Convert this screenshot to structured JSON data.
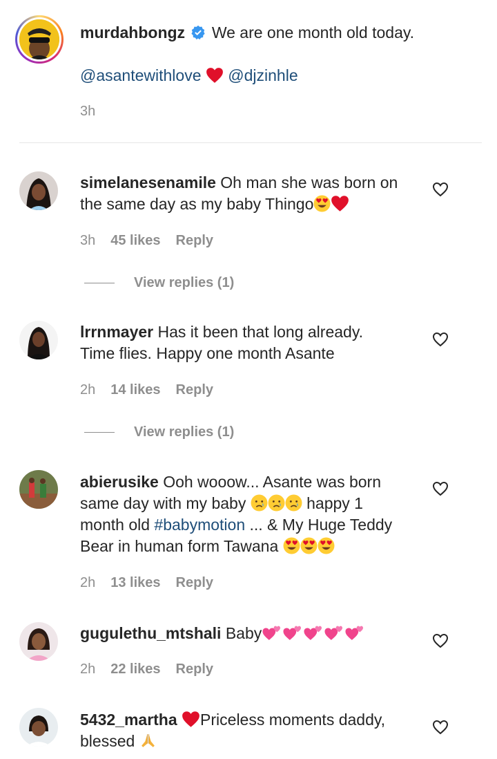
{
  "post": {
    "username": "murdahbongz",
    "caption": "We are one month old today.",
    "mention1": "@asantewithlove",
    "mention2": "@djzinhle",
    "time": "3h"
  },
  "comments": [
    {
      "username": "simelanesenamile",
      "line1": "Oh man she was born on",
      "line2": "the same day as my baby Thingo",
      "time": "3h",
      "likes": "45 likes",
      "reply": "Reply",
      "view_replies": "View replies (1)"
    },
    {
      "username": "lrrnmayer",
      "line1": "Has it been that long already.",
      "line2": "Time flies. Happy one month Asante",
      "time": "2h",
      "likes": "14 likes",
      "reply": "Reply",
      "view_replies": "View replies (1)"
    },
    {
      "username": "abierusike",
      "line1": "Ooh wooow... Asante was born",
      "line2a": "same day with my baby",
      "line2b": "happy 1",
      "line3a": "month old",
      "hashtag": "#babymotion",
      "line3b": "... & My Huge Teddy",
      "line4": "Bear in human form Tawana",
      "time": "2h",
      "likes": "13 likes",
      "reply": "Reply"
    },
    {
      "username": "gugulethu_mtshali",
      "line1": "Baby",
      "time": "2h",
      "likes": "22 likes",
      "reply": "Reply"
    },
    {
      "username": "5432_martha",
      "line1": "Priceless moments daddy,",
      "line2": "blessed"
    }
  ],
  "icons": {
    "verified": "verified-badge-icon",
    "heart": "heart-outline-icon",
    "red_heart": "red-heart-emoji",
    "heart_eyes": "heart-eyes-emoji",
    "crying": "crying-face-emoji",
    "pink_hearts": "two-hearts-emoji",
    "praying": "folded-hands-emoji"
  },
  "colors": {
    "mention": "#1f4e79",
    "muted": "#8e8e8e",
    "verified": "#3897f0",
    "heart_red": "#e0102a"
  }
}
